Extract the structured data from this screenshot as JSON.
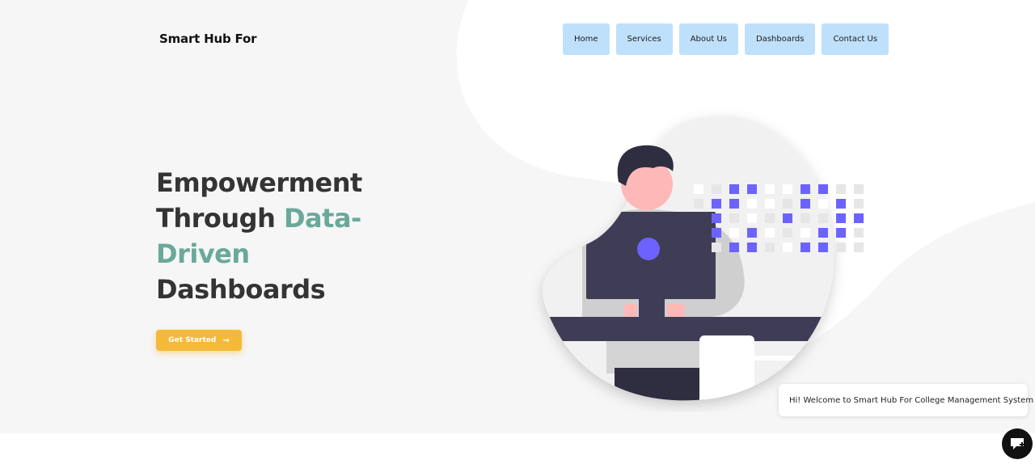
{
  "brand": {
    "name": "Smart Hub For College Management System"
  },
  "nav": {
    "items": [
      {
        "label": "Home"
      },
      {
        "label": "Services"
      },
      {
        "label": "About Us"
      },
      {
        "label": "Dashboards"
      },
      {
        "label": "Contact Us"
      }
    ]
  },
  "hero": {
    "line1": "Empowerment",
    "line2_plain": "Through ",
    "line2_accent": "Data-",
    "line3_accent": "Driven",
    "line4": "Dashboards",
    "cta_label": "Get Started",
    "cta_icon": "arrow-right-icon"
  },
  "chat": {
    "welcome": "Hi! Welcome to Smart Hub For College Management System",
    "launcher_icon": "chat-icon"
  },
  "colors": {
    "nav_bg": "#bfe0fb",
    "accent_text": "#6aa99a",
    "cta_bg": "#f5b93a",
    "hero_bg": "#f6f6f6",
    "illustration_purple": "#6c63ff",
    "monitor": "#3f3d56"
  }
}
